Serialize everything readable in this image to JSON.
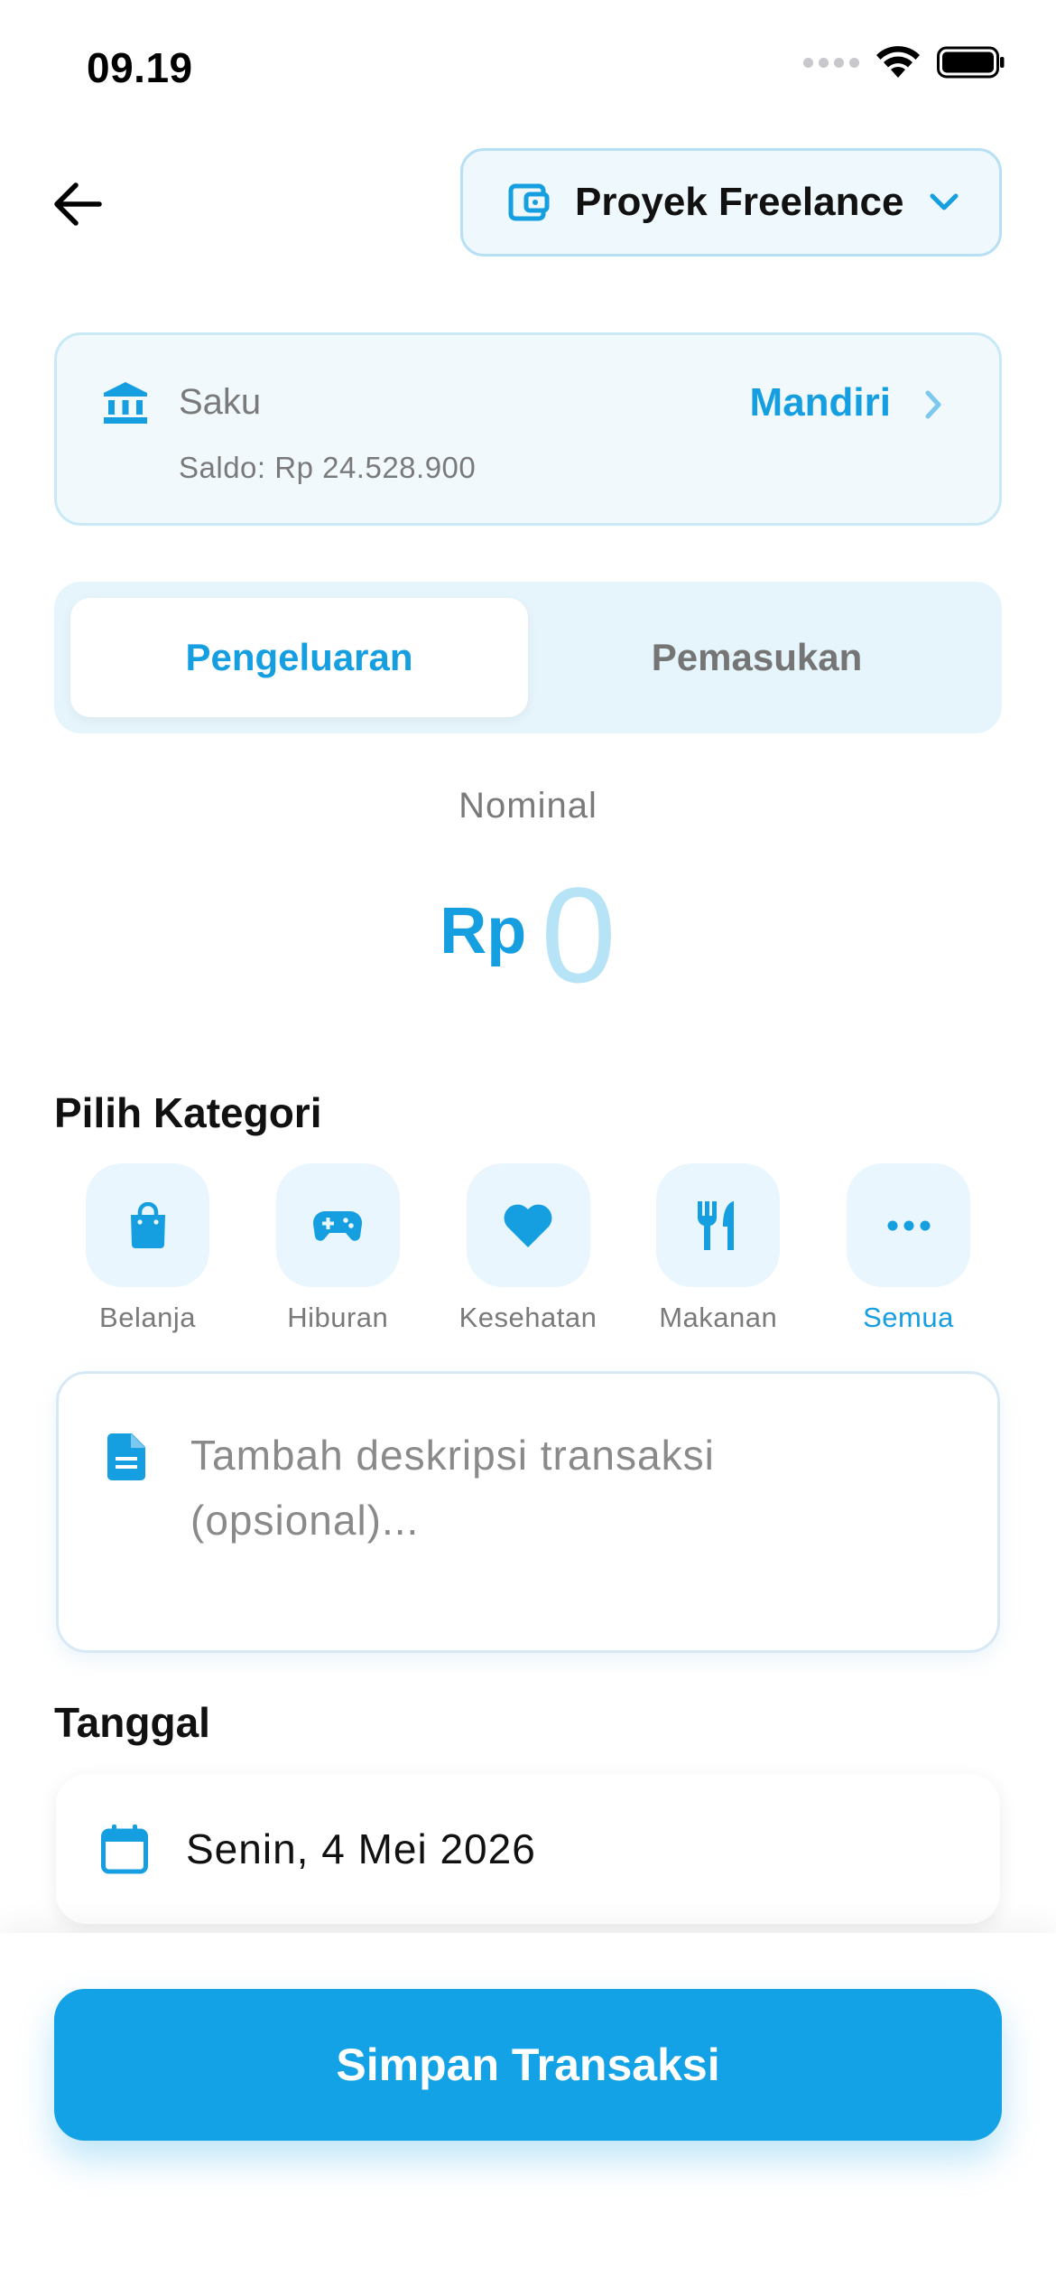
{
  "status_bar": {
    "time": "09.19"
  },
  "header": {
    "back_icon": "arrow-left-icon",
    "wallet_icon": "wallet-icon",
    "wallet_name": "Proyek Freelance"
  },
  "saku": {
    "icon": "bank-icon",
    "label": "Saku",
    "bank": "Mandiri",
    "balance": "Saldo: Rp 24.528.900"
  },
  "tabs": [
    {
      "label": "Pengeluaran",
      "active": true
    },
    {
      "label": "Pemasukan",
      "active": false
    }
  ],
  "nominal": {
    "label": "Nominal",
    "currency": "Rp",
    "value": "0"
  },
  "category_section": {
    "title": "Pilih Kategori",
    "items": [
      {
        "label": "Belanja",
        "icon": "shopping-bag-icon"
      },
      {
        "label": "Hiburan",
        "icon": "gamepad-icon"
      },
      {
        "label": "Kesehatan",
        "icon": "heart-icon"
      },
      {
        "label": "Makanan",
        "icon": "utensils-icon"
      },
      {
        "label": "Semua",
        "icon": "more-icon"
      }
    ]
  },
  "description": {
    "icon": "document-icon",
    "placeholder": "Tambah deskripsi transaksi (opsional)..."
  },
  "date_section": {
    "title": "Tanggal",
    "icon": "calendar-icon",
    "value": "Senin, 4 Mei 2026"
  },
  "save_button": {
    "label": "Simpan Transaksi"
  },
  "colors": {
    "accent": "#13a2e6",
    "accent_light": "#e9f6fd",
    "muted": "#7a7a7a"
  }
}
